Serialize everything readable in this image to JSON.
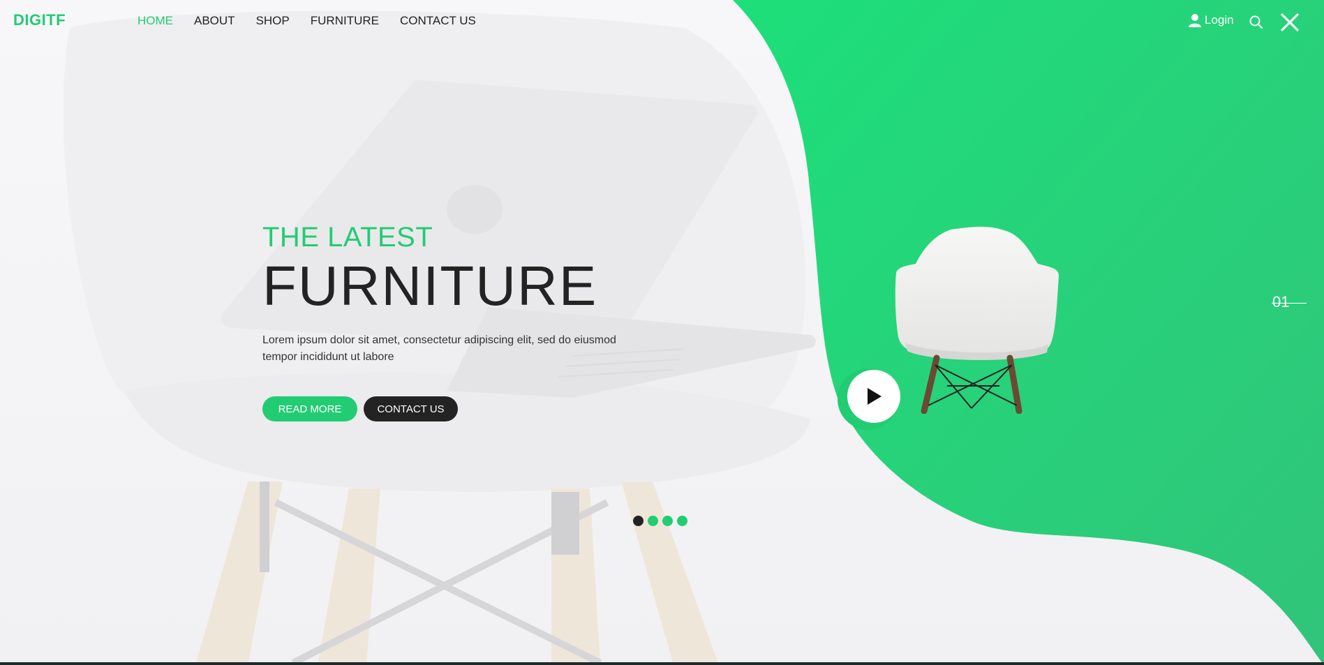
{
  "brand": {
    "logo": "DIGITF",
    "accent": "#22cc73",
    "dark": "#232323"
  },
  "nav": {
    "items": [
      {
        "label": "HOME",
        "active": true
      },
      {
        "label": "ABOUT"
      },
      {
        "label": "SHOP"
      },
      {
        "label": "FURNITURE"
      },
      {
        "label": "CONTACT US"
      }
    ]
  },
  "header": {
    "login_label": "Login",
    "login_icon": "user-icon",
    "search_icon": "search-icon",
    "close_icon": "close-icon"
  },
  "hero": {
    "subtitle": "THE LATEST",
    "title": "FURNITURE",
    "description": "Lorem ipsum dolor sit amet, consectetur adipiscing elit, sed do eiusmod tempor incididunt ut labore",
    "read_more_label": "READ MORE",
    "contact_label": "CONTACT US"
  },
  "slider": {
    "current": "01",
    "dots": 4,
    "active_dot": 1
  },
  "media": {
    "play_icon": "play-icon",
    "product_image": "white-chair-image"
  }
}
